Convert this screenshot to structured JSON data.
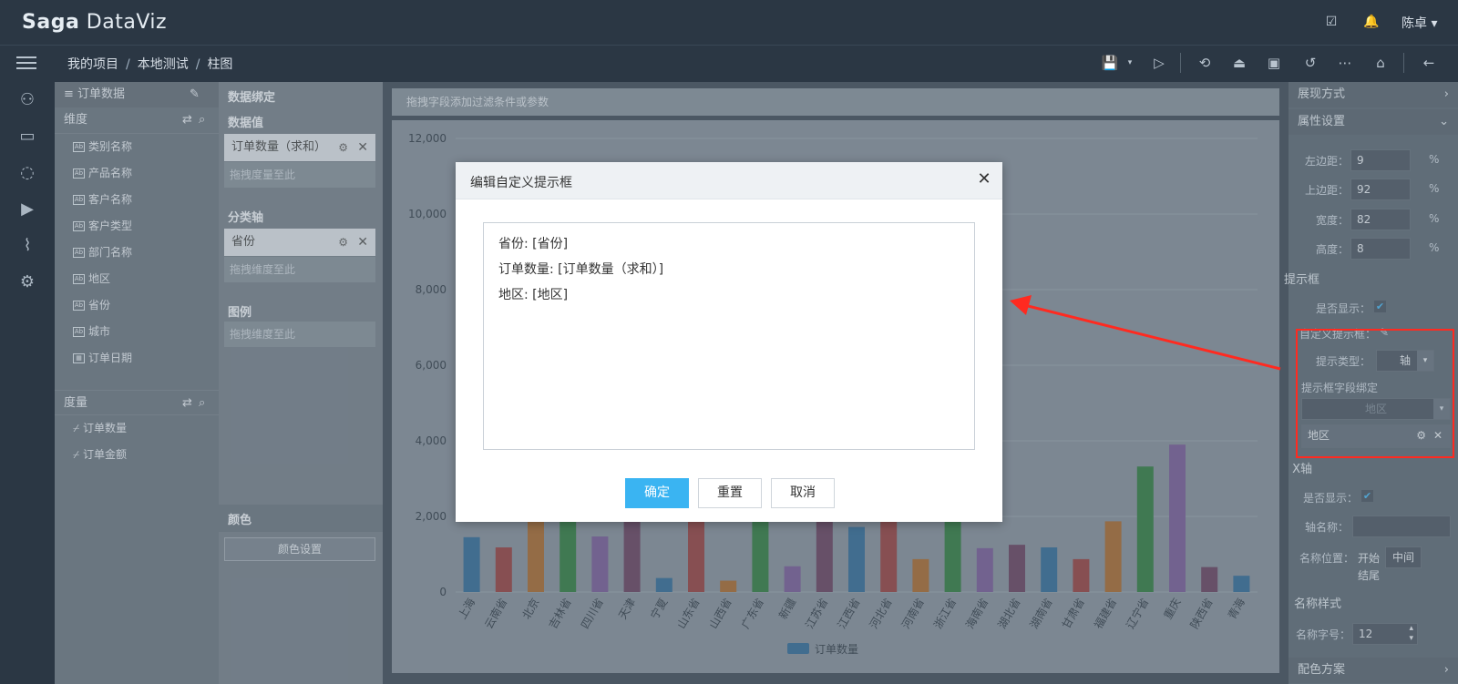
{
  "app": {
    "logo_prefix": "Saga",
    "logo_suffix": "DataViz",
    "user": "陈卓"
  },
  "breadcrumb": [
    "我的项目",
    "本地测试",
    "柱图"
  ],
  "data_panel": {
    "title": "订单数据",
    "dimensions_label": "维度",
    "dimensions": [
      "类别名称",
      "产品名称",
      "客户名称",
      "客户类型",
      "部门名称",
      "地区",
      "省份",
      "城市",
      "订单日期"
    ],
    "measures_label": "度量",
    "measures": [
      "订单数量",
      "订单金额"
    ]
  },
  "binding": {
    "title": "数据绑定",
    "values_label": "数据值",
    "values_chip": "订单数量（求和）",
    "values_placeholder": "拖拽度量至此",
    "axis_label": "分类轴",
    "axis_chip": "省份",
    "axis_placeholder": "拖拽维度至此",
    "legend_label": "图例",
    "legend_placeholder": "拖拽维度至此",
    "color_label": "颜色",
    "color_button": "颜色设置"
  },
  "filter_bar": {
    "placeholder": "拖拽字段添加过滤条件或参数"
  },
  "chart_data": {
    "type": "bar",
    "categories": [
      "上海",
      "云南省",
      "北京",
      "吉林省",
      "四川省",
      "天津",
      "宁夏",
      "山东省",
      "山西省",
      "广东省",
      "新疆",
      "江苏省",
      "江西省",
      "河北省",
      "河南省",
      "浙江省",
      "海南省",
      "湖北省",
      "湖南省",
      "甘肃省",
      "福建省",
      "辽宁省",
      "重庆",
      "陕西省",
      "青海"
    ],
    "series": [
      {
        "name": "订单数量",
        "values": [
          1450,
          1180,
          2500,
          2600,
          1470,
          2300,
          370,
          2800,
          300,
          2400,
          680,
          2300,
          1720,
          2400,
          870,
          1900,
          1160,
          1250,
          1180,
          870,
          1870,
          3320,
          3900,
          660,
          430
        ]
      }
    ],
    "colors": [
      "#1f5c8c",
      "#8b2e2e",
      "#9e5b1c",
      "#1e6f2f",
      "#6b4c8c",
      "#5a3050"
    ],
    "yticks": [
      "0",
      "2,000",
      "4,000",
      "6,000",
      "8,000",
      "10,000",
      "12,000"
    ],
    "ylim": [
      0,
      12000
    ],
    "legend": "bottom-center",
    "grid": true
  },
  "right_panel": {
    "display_mode": "展现方式",
    "property_settings": "属性设置",
    "left_margin_label": "左边距：",
    "left_margin": "9",
    "top_margin_label": "上边距：",
    "top_margin": "92",
    "width_label": "宽度：",
    "width": "82",
    "height_label": "高度：",
    "height": "8",
    "pct": "%",
    "tooltip_section": "提示框",
    "show_label": "是否显示：",
    "custom_tooltip_label": "自定义提示框：",
    "tooltip_type_label": "提示类型：",
    "tooltip_type": "轴",
    "tooltip_field_binding": "提示框字段绑定",
    "field_select_placeholder": "地区",
    "field_chip": "地区",
    "xaxis_section": "X轴",
    "axis_name_label": "轴名称：",
    "name_position_label": "名称位置：",
    "pos_start": "开始",
    "pos_middle": "中间",
    "pos_end": "结尾",
    "name_style_label": "名称样式",
    "font_size_label": "名称字号：",
    "font_size": "12",
    "color_scheme": "配色方案"
  },
  "modal": {
    "title": "编辑自定义提示框",
    "lines": [
      "省份: [省份]",
      "订单数量: [订单数量（求和）]",
      "地区: [地区]"
    ],
    "ok": "确定",
    "reset": "重置",
    "cancel": "取消"
  }
}
